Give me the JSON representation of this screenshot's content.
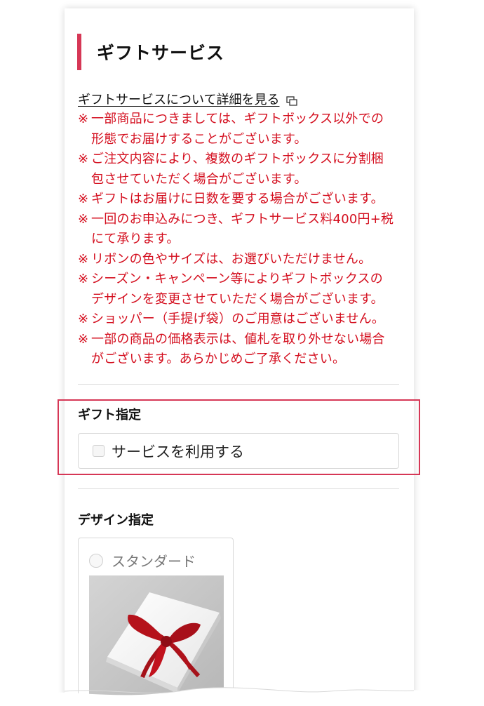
{
  "gift_service": {
    "title": "ギフトサービス",
    "detail_link": "ギフトサービスについて詳細を見る",
    "notes": [
      {
        "mark": "※",
        "lines": [
          "一部商品につきましては、ギフトボックス以外での",
          "形態でお届けすることがございます。"
        ]
      },
      {
        "mark": "※",
        "lines": [
          "ご注文内容により、複数のギフトボックスに分割梱",
          "包させていただく場合がございます。"
        ]
      },
      {
        "mark": "※",
        "lines": [
          "ギフトはお届けに日数を要する場合がございます。"
        ]
      },
      {
        "mark": "※",
        "lines": [
          "一回のお申込みにつき、ギフトサービス料400円+税",
          "にて承ります。"
        ]
      },
      {
        "mark": "※",
        "lines": [
          "リボンの色やサイズは、お選びいただけません。"
        ]
      },
      {
        "mark": "※",
        "lines": [
          "シーズン・キャンペーン等によりギフトボックスの",
          "デザインを変更させていただく場合がございます。"
        ]
      },
      {
        "mark": "※",
        "lines": [
          "ショッパー（手提げ袋）のご用意はございません。"
        ]
      },
      {
        "mark": "※",
        "lines": [
          "一部の商品の価格表示は、値札を取り外せない場合",
          "がございます。あらかじめご了承ください。"
        ]
      }
    ]
  },
  "gift_designation": {
    "title": "ギフト指定",
    "option_label": "サービスを利用する",
    "checked": false
  },
  "design_designation": {
    "title": "デザイン指定",
    "options": [
      {
        "label": "スタンダード",
        "selected": false
      }
    ]
  },
  "colors": {
    "accent": "#d63756",
    "note_text": "#d40f1f",
    "ribbon": "#b5121b"
  },
  "icons": {
    "detail_link_icon": "external-window-icon"
  }
}
